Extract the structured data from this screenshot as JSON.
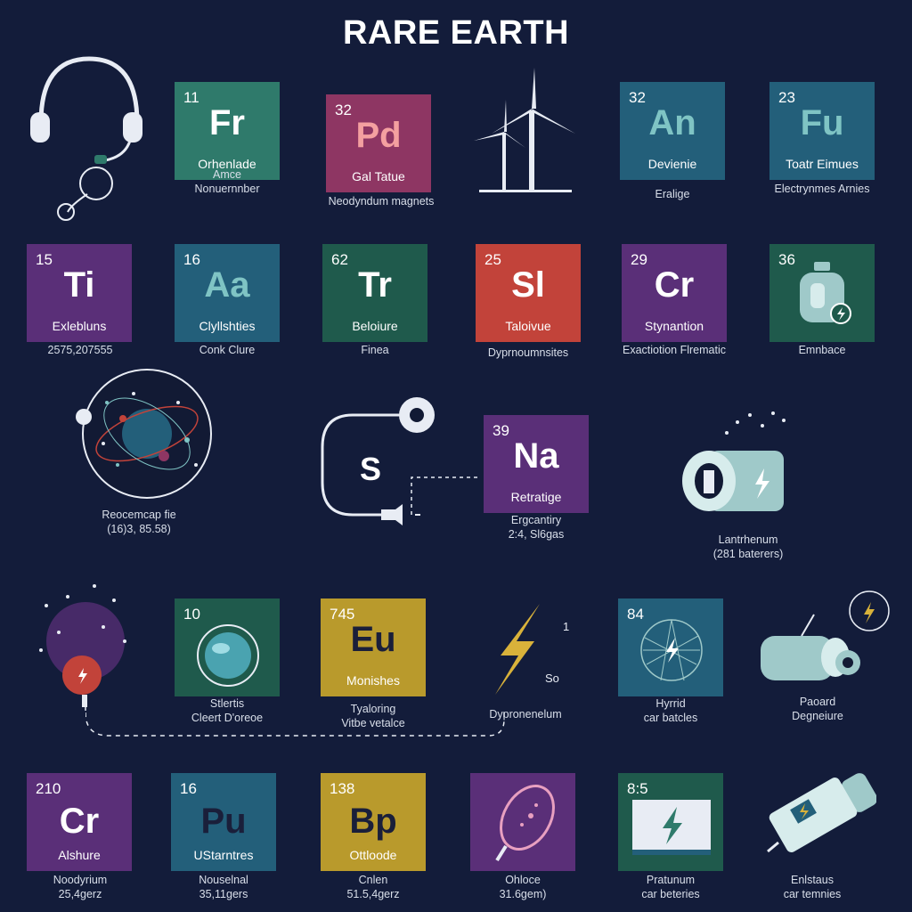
{
  "title": "RARE EARTH",
  "colors": {
    "background": "#131c3a",
    "green": "#2f7a6b",
    "teal": "#235f7a",
    "magenta": "#8e3663",
    "purple": "#5a2f78",
    "red": "#c2433a",
    "gold": "#b99a2c",
    "darkgreen": "#1f5a4c"
  },
  "row1": {
    "fr": {
      "num": "11",
      "sym": "Fr",
      "name": "Orhenlade",
      "cap1": "Amce",
      "cap2": "Nonuernnber"
    },
    "pd": {
      "num": "32",
      "sym": "Pd",
      "name": "Gal Tatue",
      "cap1": "Neodyndum magnets"
    },
    "an": {
      "num": "32",
      "sym": "An",
      "name": "Devienie",
      "cap1": "Eralige"
    },
    "fu": {
      "num": "23",
      "sym": "Fu",
      "name": "Toatr Eimues",
      "cap1": "Electrynmes Arnies"
    }
  },
  "row2": {
    "ti": {
      "num": "15",
      "sym": "Ti",
      "name": "Exlebluns",
      "cap1": "2575,207555"
    },
    "aa": {
      "num": "16",
      "sym": "Aa",
      "name": "Clyllshties",
      "cap1": "Conk Clure"
    },
    "tr": {
      "num": "62",
      "sym": "Tr",
      "name": "Beloiure",
      "cap1": "Finea"
    },
    "sl": {
      "num": "25",
      "sym": "Sl",
      "name": "Taloivue",
      "cap1": "Dyprnoumnsites"
    },
    "cr": {
      "num": "29",
      "sym": "Cr",
      "name": "Stynantion",
      "cap1": "Exactiotion Flrematic"
    },
    "lotion": {
      "num": "36",
      "cap1": "Emnbace"
    }
  },
  "row3": {
    "atom": {
      "cap1": "Reocemcap fie",
      "cap2": "(16)3, 85.58)"
    },
    "s": {
      "sym": "S"
    },
    "na": {
      "num": "39",
      "sym": "Na",
      "name": "Retratige",
      "cap1": "Ergcantiry",
      "cap2": "2:4, Sl6gas"
    },
    "battery": {
      "cap1": "Lantrhenum",
      "cap2": "(281 baterers)"
    }
  },
  "row4": {
    "bulb": {},
    "sphere": {
      "num": "10",
      "cap1": "Stlertis",
      "cap2": "Cleert D'oreoe"
    },
    "eu": {
      "num": "745",
      "sym": "Eu",
      "name": "Monishes",
      "cap1": "Tyaloring",
      "cap2": "Vitbe vetalce"
    },
    "bolt": {
      "side1": "1",
      "side2": "So",
      "cap1": "Dypronenelum"
    },
    "net": {
      "num": "84",
      "cap1": "Hyrrid",
      "cap2": "car batcles"
    },
    "motor": {
      "cap1": "Paoard",
      "cap2": "Degneiure"
    }
  },
  "row5": {
    "cr": {
      "num": "210",
      "sym": "Cr",
      "name": "Alshure",
      "cap1": "Noodyrium",
      "cap2": "25,4gerz"
    },
    "pu": {
      "num": "16",
      "sym": "Pu",
      "name": "UStarntres",
      "cap1": "Nouselnal",
      "cap2": "35,11gers"
    },
    "bp": {
      "num": "138",
      "sym": "Bp",
      "name": "Ottloode",
      "cap1": "Cnlen",
      "cap2": "51.5,4gerz"
    },
    "capsule": {
      "cap1": "Ohloce",
      "cap2": "31.6gem)"
    },
    "screen": {
      "num": "8:5",
      "cap1": "Pratunum",
      "cap2": "car beteries"
    },
    "connector": {
      "cap1": "Enlstaus",
      "cap2": "car temnies"
    }
  }
}
